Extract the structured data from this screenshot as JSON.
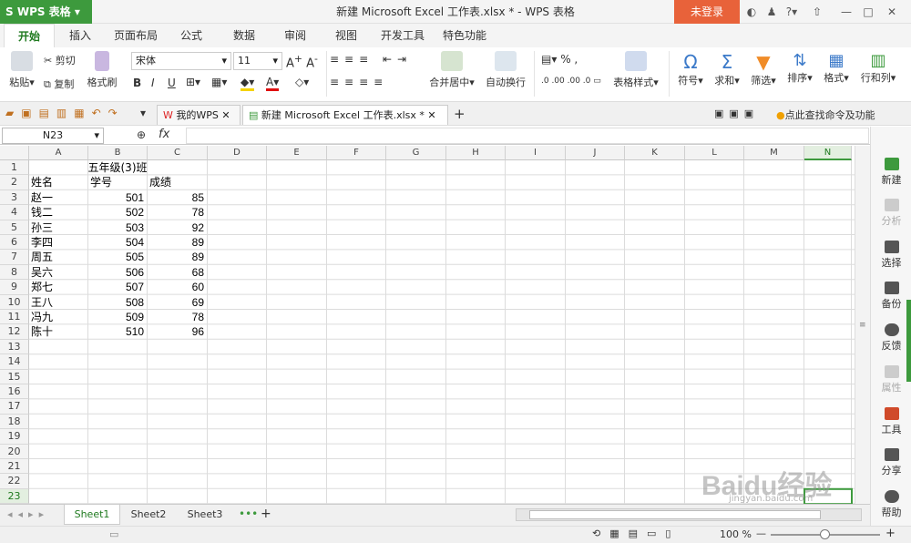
{
  "app": {
    "name": "WPS 表格",
    "title": "新建 Microsoft Excel 工作表.xlsx * - WPS 表格",
    "login": "未登录"
  },
  "ribbon_tabs": [
    "开始",
    "插入",
    "页面布局",
    "公式",
    "数据",
    "审阅",
    "视图",
    "开发工具",
    "特色功能"
  ],
  "ribbon": {
    "paste": "粘贴",
    "cut": "剪切",
    "copy": "复制",
    "format_painter": "格式刷",
    "font_name": "宋体",
    "font_size": "11",
    "merge_center": "合并居中",
    "wrap_text": "自动换行",
    "table_style": "表格样式",
    "symbol": "符号",
    "sum": "求和",
    "filter": "筛选",
    "sort": "排序",
    "format": "格式",
    "rowcol": "行和列",
    "percent": "%",
    "dec_inc": ".0\n.00",
    "dec_dec": ".00\n.0"
  },
  "doc_tabs": [
    {
      "label": "我的WPS"
    },
    {
      "label": "新建 Microsoft Excel 工作表.xlsx *"
    }
  ],
  "find_cmd": "点此查找命令及功能",
  "formula_bar": {
    "name_box": "N23",
    "fx": "fx",
    "content": ""
  },
  "columns": [
    "A",
    "B",
    "C",
    "D",
    "E",
    "F",
    "G",
    "H",
    "I",
    "J",
    "K",
    "L",
    "M",
    "N"
  ],
  "rows": [
    "1",
    "2",
    "3",
    "4",
    "5",
    "6",
    "7",
    "8",
    "9",
    "10",
    "11",
    "12",
    "13",
    "14",
    "15",
    "16",
    "17",
    "18",
    "19",
    "20",
    "21",
    "22",
    "23"
  ],
  "cells": {
    "title": "五年级(3)班",
    "headers": [
      "姓名",
      "学号",
      "成绩"
    ],
    "data": [
      [
        "赵一",
        "501",
        "85"
      ],
      [
        "钱二",
        "502",
        "78"
      ],
      [
        "孙三",
        "503",
        "92"
      ],
      [
        "李四",
        "504",
        "89"
      ],
      [
        "周五",
        "505",
        "89"
      ],
      [
        "吴六",
        "506",
        "68"
      ],
      [
        "郑七",
        "507",
        "60"
      ],
      [
        "王八",
        "508",
        "69"
      ],
      [
        "冯九",
        "509",
        "78"
      ],
      [
        "陈十",
        "510",
        "96"
      ]
    ]
  },
  "sheets": [
    "Sheet1",
    "Sheet2",
    "Sheet3"
  ],
  "right_panel": [
    "新建",
    "分析",
    "选择",
    "备份",
    "反馈",
    "属性",
    "工具",
    "分享",
    "帮助"
  ],
  "status": {
    "zoom": "100 %"
  },
  "watermark": {
    "brand": "Baidu经验",
    "url": "jingyan.baidu.com"
  },
  "colors": {
    "green": "#3d9a3d",
    "orange": "#e8623a",
    "selected": "#1f7a1f"
  }
}
